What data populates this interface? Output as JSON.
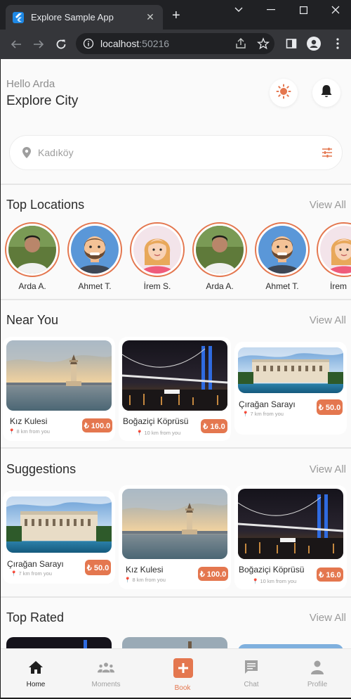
{
  "browser": {
    "tab_title": "Explore Sample App",
    "url_host": "localhost",
    "url_port": ":50216"
  },
  "header": {
    "greeting": "Hello Arda",
    "title": "Explore City"
  },
  "search": {
    "value": "Kadıköy"
  },
  "sections": {
    "top_locations": "Top Locations",
    "near_you": "Near You",
    "suggestions": "Suggestions",
    "top_rated": "Top Rated",
    "view_all": "View All"
  },
  "stories": [
    {
      "name": "Arda A.",
      "avatar": "photo-man"
    },
    {
      "name": "Ahmet T.",
      "avatar": "cartoon-bearded-man"
    },
    {
      "name": "İrem S.",
      "avatar": "cartoon-woman"
    },
    {
      "name": "Arda A.",
      "avatar": "photo-man"
    },
    {
      "name": "Ahmet T.",
      "avatar": "cartoon-bearded-man"
    },
    {
      "name": "İrem",
      "avatar": "cartoon-woman"
    }
  ],
  "near_you": [
    {
      "name": "Kız Kulesi",
      "distance": "8 km from you",
      "price": "₺ 100.0",
      "image": "maiden-tower"
    },
    {
      "name": "Boğaziçi Köprüsü",
      "distance": "10 km from you",
      "price": "₺ 16.0",
      "image": "bosphorus-bridge"
    },
    {
      "name": "Çırağan Sarayı",
      "distance": "7 km from you",
      "price": "₺ 50.0",
      "image": "ciragan-palace"
    }
  ],
  "suggestions": [
    {
      "name": "Çırağan Sarayı",
      "distance": "7 km from you",
      "price": "₺ 50.0",
      "image": "ciragan-palace"
    },
    {
      "name": "Kız Kulesi",
      "distance": "8 km from you",
      "price": "₺ 100.0",
      "image": "maiden-tower"
    },
    {
      "name": "Boğaziçi Köprüsü",
      "distance": "10 km from you",
      "price": "₺ 16.0",
      "image": "bosphorus-bridge"
    }
  ],
  "bottom_nav": [
    {
      "label": "Home",
      "icon": "home-icon",
      "active": true
    },
    {
      "label": "Moments",
      "icon": "people-icon",
      "active": false
    },
    {
      "label": "Book",
      "icon": "add-box-icon",
      "active": false
    },
    {
      "label": "Chat",
      "icon": "chat-icon",
      "active": false
    },
    {
      "label": "Profile",
      "icon": "person-icon",
      "active": false
    }
  ],
  "colors": {
    "accent": "#e4774f",
    "background": "#fafafa",
    "text": "#2b2b2b"
  }
}
